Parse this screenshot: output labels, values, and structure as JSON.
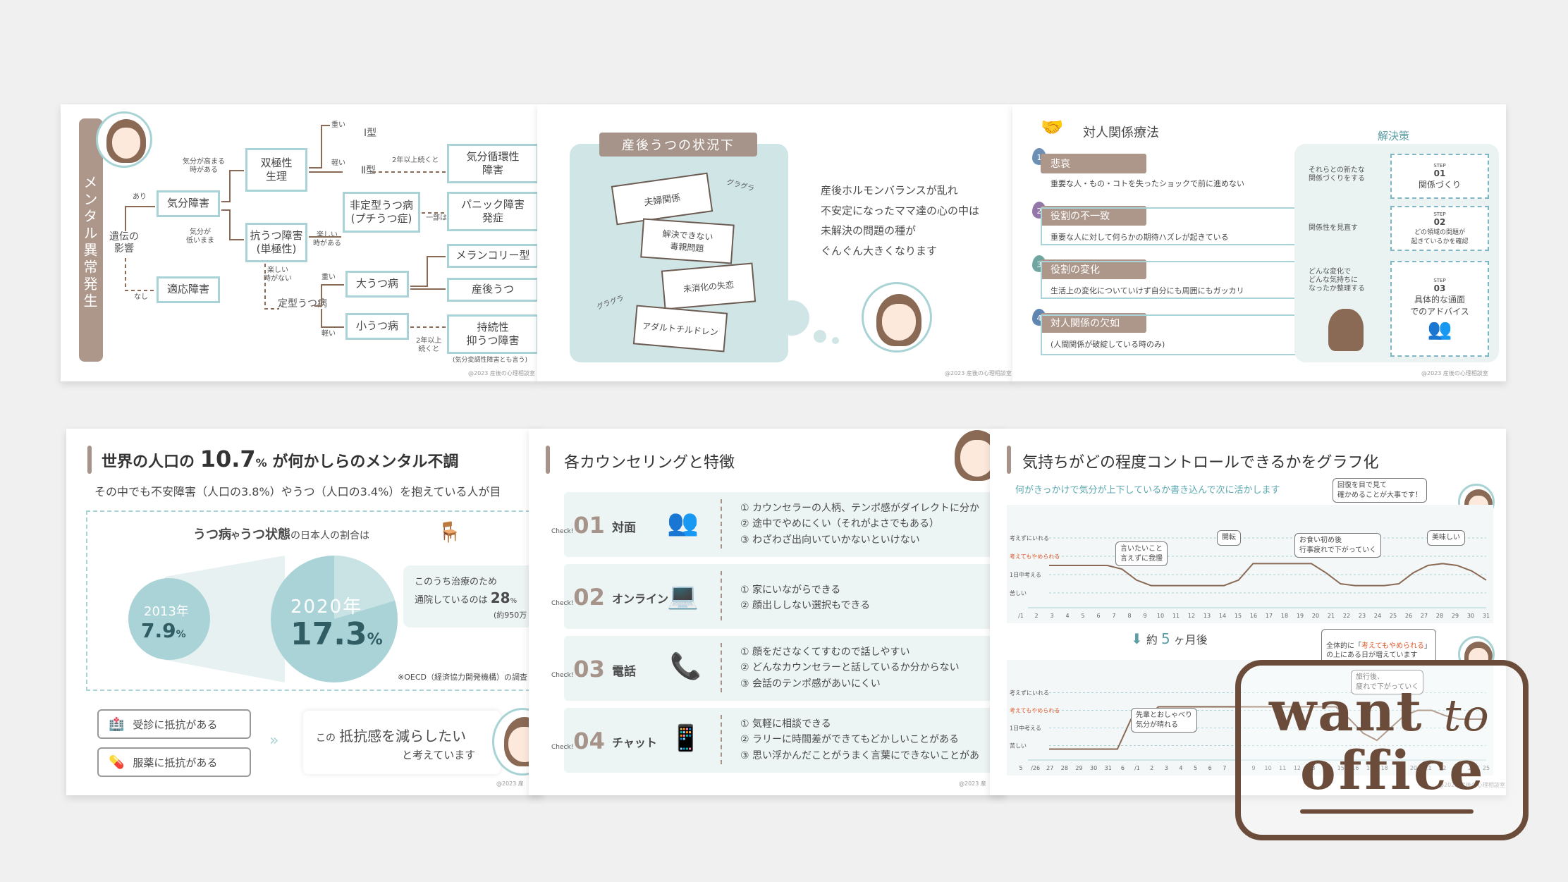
{
  "slide1": {
    "title": "メンタル異常発生",
    "heredity": "遺伝の\n影響",
    "yes": "あり",
    "no": "なし",
    "mood_disorder": "気分障害",
    "adjustment": "適応障害",
    "mood_rise": "気分が高まる\n時がある",
    "mood_low": "気分が\n低いまま",
    "bipolar": "双極性\n生理",
    "depressive": "抗うつ障害\n(単極性)",
    "heavy": "重い",
    "light": "軽い",
    "type1": "Ⅰ型",
    "type2": "Ⅱ型",
    "two_years": "2年以上続くと",
    "cyclothymic": "気分循環性\n障害",
    "fun_time": "楽しい\n時がある",
    "atypical": "非定型うつ病\n(プチうつ症)",
    "partial": "一部は",
    "panic": "パニック障害\n発症",
    "no_fun": "楽しい\n時がない",
    "typical": "定型うつ病",
    "major": "大うつ病",
    "minor": "小うつ病",
    "heavy2": "重い",
    "light2": "軽い",
    "melancholic": "メランコリー型",
    "postpartum": "産後うつ",
    "persistent": "持続性\n抑うつ障害",
    "two_years2": "2年以上\n続くと",
    "footnote": "(気分変調性障害とも言う)",
    "copyright": "@2023 産後の心理相談室"
  },
  "slide2": {
    "header": "産後うつの状況下",
    "cards": [
      "夫婦関係",
      "解決できない\n毒親問題",
      "未消化の失恋",
      "アダルトチルドレン"
    ],
    "gura1": "グラグラ",
    "gura2": "グラグラ",
    "text": "産後ホルモンバランスが乱れ\n不安定になったママ達の心の中は\n未解決の問題の種が\nぐんぐん大きくなります",
    "copyright": "@2023 産後の心理相談室"
  },
  "slide3": {
    "title": "対人関係療法",
    "solution": "解決策",
    "items": [
      {
        "num": "1",
        "label": "悲哀",
        "text": "重要な人・もの・コトを失ったショックで前に進めない"
      },
      {
        "num": "2",
        "label": "役割の不一致",
        "text": "重要な人に対して何らかの期待ハズレが起きている"
      },
      {
        "num": "3",
        "label": "役割の変化",
        "text": "生活上の変化についていけず自分にも周囲にもガッカリ"
      },
      {
        "num": "4",
        "label": "対人関係の欠如",
        "text": "(人間関係が破綻している時のみ)"
      }
    ],
    "mid": [
      "それらとの新たな\n関係づくりをする",
      "関係性を見直す",
      "どんな変化で\nどんな気持ちに\nなったか整理する"
    ],
    "steps": [
      {
        "step": "STEP",
        "num": "01",
        "text": "関係づくり"
      },
      {
        "step": "STEP",
        "num": "02",
        "text": "どの領域の問題が\n起きているかを確認"
      },
      {
        "step": "STEP",
        "num": "03",
        "text": "具体的な通面\nでのアドバイス"
      }
    ],
    "copyright": "@2023 産後の心理相談室"
  },
  "slide4": {
    "title_pre": "世界の人口の",
    "title_num": "10.7",
    "title_pct": "%",
    "title_post": "が何かしらのメンタル不調",
    "subtitle": "その中でも不安障害（人口の3.8%）やうつ（人口の3.4%）を抱えている人が目",
    "box_title_a": "うつ病",
    "box_title_b": "や",
    "box_title_c": "うつ状態",
    "box_title_d": "の日本人の割合は",
    "y2013": "2013年",
    "v2013": "7.9",
    "y2020": "2020年",
    "v2020": "17.3",
    "pct": "%",
    "callout_a": "このうち治療のため",
    "callout_b": "通院しているのは",
    "callout_num": "28",
    "callout_pct": "%",
    "callout_c": "(約950万",
    "source": "※OECD（経済協力開発機構）の調査",
    "resist1": "受診に抵抗がある",
    "resist2": "服薬に抵抗がある",
    "reduce_a": "この",
    "reduce_b": "抵抗感を減らしたい",
    "reduce_c": "と考えています",
    "copyright": "@2023 産"
  },
  "slide5": {
    "title": "各カウンセリングと特徴",
    "check": "Check!",
    "rows": [
      {
        "num": "01",
        "label": "対面",
        "points": [
          "① カウンセラーの人柄、テンポ感がダイレクトに分か",
          "② 途中でやめにくい（それがよさでもある）",
          "③ わざわざ出向いていかないといけない"
        ]
      },
      {
        "num": "02",
        "label": "オンライン",
        "points": [
          "① 家にいながらできる",
          "② 顔出ししない選択もできる"
        ]
      },
      {
        "num": "03",
        "label": "電話",
        "points": [
          "① 顔をださなくてすむので話しやすい",
          "② どんなカウンセラーと話しているか分からない",
          "③ 会話のテンポ感があいにくい"
        ]
      },
      {
        "num": "04",
        "label": "チャット",
        "points": [
          "① 気軽に相談できる",
          "② ラリーに時間差ができてもどかしいことがある",
          "③ 思い浮かんだことがうまく言葉にできないことがあ"
        ]
      }
    ],
    "copyright": "@2023 産"
  },
  "slide6": {
    "title": "気持ちがどの程度コントロールできるかをグラフ化",
    "subtitle": "何がきっかけで気分が上下しているか書き込んで次に活かします",
    "bubble_top": "回復を目で見て\n確かめることが大事です！",
    "levels": [
      "考えずにいれる",
      "考えてもやめられる",
      "1日中考える",
      "苦しい"
    ],
    "notes1": [
      "言いたいこと\n言えずに我慢",
      "開転",
      "お食い初め後\n行事疲れで下がっていく",
      "美味しい"
    ],
    "xaxis1_start": "1",
    "xaxis1_ticks": [
      "/1",
      "2",
      "3",
      "4",
      "5",
      "6",
      "7",
      "8",
      "9",
      "10",
      "11",
      "12",
      "13",
      "14",
      "15",
      "16",
      "17",
      "18",
      "19",
      "20",
      "21",
      "22",
      "23",
      "24",
      "25",
      "26",
      "27",
      "28",
      "29",
      "30",
      "31"
    ],
    "later_a": "約",
    "later_num": "5",
    "later_b": "ヶ月後",
    "bubble_mid_a": "全体的に「",
    "bubble_mid_hl": "考えてもやめられる",
    "bubble_mid_b": "」\nの上にある日が増えています",
    "notes2": [
      "旅行後、\n疲れで下がっていく",
      "先輩とおしゃべり\n気分が晴れる"
    ],
    "xaxis2_ticks": [
      "5",
      "/26",
      "27",
      "28",
      "29",
      "30",
      "31",
      "6",
      "/1",
      "2",
      "3",
      "4",
      "5",
      "6",
      "7",
      "8",
      "9",
      "10",
      "11",
      "12",
      "13",
      "14",
      "15",
      "16",
      "17",
      "18",
      "19",
      "20",
      "21",
      "22",
      "23",
      "24",
      "25"
    ],
    "copyright": "@2023 産後の心理相談室",
    "chart_data": [
      {
        "type": "line",
        "x": [
          1,
          2,
          3,
          4,
          5,
          6,
          7,
          8,
          9,
          10,
          11,
          12,
          13,
          14,
          15,
          16,
          17,
          18,
          19,
          20,
          21,
          22,
          23,
          24,
          25,
          26,
          27,
          28,
          29,
          30,
          31
        ],
        "values": [
          2,
          2,
          2,
          2,
          2,
          1.8,
          1.2,
          0.9,
          0.9,
          0.9,
          0.9,
          0.9,
          0.9,
          1.2,
          2.1,
          2.1,
          2.1,
          2.1,
          2.1,
          1.6,
          1.0,
          0.9,
          0.9,
          0.9,
          1.0,
          1.6,
          2.0,
          2.1,
          2.0,
          1.7,
          1.2
        ],
        "levels": [
          "苦しい",
          "1日中考える",
          "考えてもやめられる",
          "考えずにいれる"
        ],
        "ylim": [
          0,
          4
        ]
      },
      {
        "type": "line",
        "x": [
          1,
          2,
          3,
          4,
          5,
          6,
          7,
          8,
          9,
          10,
          11,
          12,
          13,
          14,
          15,
          16,
          17,
          18,
          19,
          20,
          21,
          22,
          23,
          24,
          25,
          26,
          27,
          28,
          29,
          30,
          31,
          32,
          33
        ],
        "values": [
          0.3,
          0.3,
          0.3,
          0.3,
          0.3,
          0.3,
          2.0,
          2.0,
          2.7,
          2.7,
          2.7,
          2.7,
          2.7,
          2.7,
          2.7,
          2.7,
          2.7,
          2.7,
          2.7,
          2.7,
          2.7,
          2.7,
          2.0,
          1.2,
          0.8,
          1.5,
          2.2,
          2.5,
          2.5,
          2.2,
          2.0,
          2.0,
          2.0
        ],
        "levels": [
          "苦しい",
          "1日中考える",
          "考えてもやめられる",
          "考えずにいれる"
        ],
        "ylim": [
          0,
          4
        ]
      }
    ]
  },
  "watermark": {
    "line1a": "want",
    "line1b": "to",
    "line2": "office"
  },
  "colors": {
    "accent": "#a9d3d6",
    "brown": "#ad978b",
    "teal_dark": "#5b9ea5",
    "bg_panel": "#cfe5e6"
  }
}
